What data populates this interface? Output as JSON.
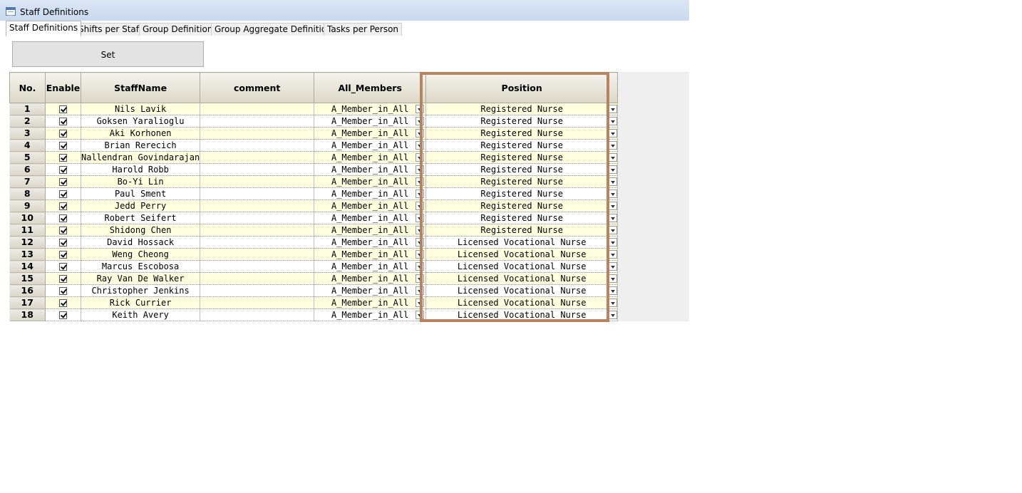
{
  "window": {
    "title": "Staff Definitions"
  },
  "tabs": [
    {
      "label": "Staff Definitions",
      "active": true
    },
    {
      "label": "Shifts per Staff",
      "active": false
    },
    {
      "label": "Group Definitions",
      "active": false
    },
    {
      "label": "Group Aggregate Definitions",
      "active": false
    },
    {
      "label": "Tasks per Person",
      "active": false
    }
  ],
  "toolbar": {
    "set_label": "Set"
  },
  "table": {
    "columns": [
      "No.",
      "Enable",
      "StaffName",
      "comment",
      "All_Members",
      "Position"
    ],
    "rows": [
      {
        "no": "1",
        "enabled": true,
        "name": "Nils Lavik",
        "comment": "",
        "members": "A_Member_in_All",
        "position": "Registered Nurse"
      },
      {
        "no": "2",
        "enabled": true,
        "name": "Goksen Yaralioglu",
        "comment": "",
        "members": "A_Member_in_All",
        "position": "Registered Nurse"
      },
      {
        "no": "3",
        "enabled": true,
        "name": "Aki Korhonen",
        "comment": "",
        "members": "A_Member_in_All",
        "position": "Registered Nurse"
      },
      {
        "no": "4",
        "enabled": true,
        "name": "Brian Rerecich",
        "comment": "",
        "members": "A_Member_in_All",
        "position": "Registered Nurse"
      },
      {
        "no": "5",
        "enabled": true,
        "name": "Nallendran Govindarajan",
        "comment": "",
        "members": "A_Member_in_All",
        "position": "Registered Nurse"
      },
      {
        "no": "6",
        "enabled": true,
        "name": "Harold Robb",
        "comment": "",
        "members": "A_Member_in_All",
        "position": "Registered Nurse"
      },
      {
        "no": "7",
        "enabled": true,
        "name": "Bo-Yi Lin",
        "comment": "",
        "members": "A_Member_in_All",
        "position": "Registered Nurse"
      },
      {
        "no": "8",
        "enabled": true,
        "name": "Paul Sment",
        "comment": "",
        "members": "A_Member_in_All",
        "position": "Registered Nurse"
      },
      {
        "no": "9",
        "enabled": true,
        "name": "Jedd Perry",
        "comment": "",
        "members": "A_Member_in_All",
        "position": "Registered Nurse"
      },
      {
        "no": "10",
        "enabled": true,
        "name": "Robert Seifert",
        "comment": "",
        "members": "A_Member_in_All",
        "position": "Registered Nurse"
      },
      {
        "no": "11",
        "enabled": true,
        "name": "Shidong Chen",
        "comment": "",
        "members": "A_Member_in_All",
        "position": "Registered Nurse"
      },
      {
        "no": "12",
        "enabled": true,
        "name": "David Hossack",
        "comment": "",
        "members": "A_Member_in_All",
        "position": "Licensed Vocational Nurse"
      },
      {
        "no": "13",
        "enabled": true,
        "name": "Weng Cheong",
        "comment": "",
        "members": "A_Member_in_All",
        "position": "Licensed Vocational Nurse"
      },
      {
        "no": "14",
        "enabled": true,
        "name": "Marcus Escobosa",
        "comment": "",
        "members": "A_Member_in_All",
        "position": "Licensed Vocational Nurse"
      },
      {
        "no": "15",
        "enabled": true,
        "name": "Ray Van De Walker",
        "comment": "",
        "members": "A_Member_in_All",
        "position": "Licensed Vocational Nurse"
      },
      {
        "no": "16",
        "enabled": true,
        "name": "Christopher Jenkins",
        "comment": "",
        "members": "A_Member_in_All",
        "position": "Licensed Vocational Nurse"
      },
      {
        "no": "17",
        "enabled": true,
        "name": "Rick Currier",
        "comment": "",
        "members": "A_Member_in_All",
        "position": "Licensed Vocational Nurse"
      },
      {
        "no": "18",
        "enabled": true,
        "name": "Keith Avery",
        "comment": "",
        "members": "A_Member_in_All",
        "position": "Licensed Vocational Nurse"
      }
    ]
  },
  "colors": {
    "highlight_border": "#b8835f",
    "row_odd": "#ffffe0",
    "titlebar": "#c9d9ee"
  },
  "icons": {
    "app": "window-app-icon",
    "dropdown": "chevron-down-icon",
    "checkbox": "checkbox-checked-icon"
  }
}
